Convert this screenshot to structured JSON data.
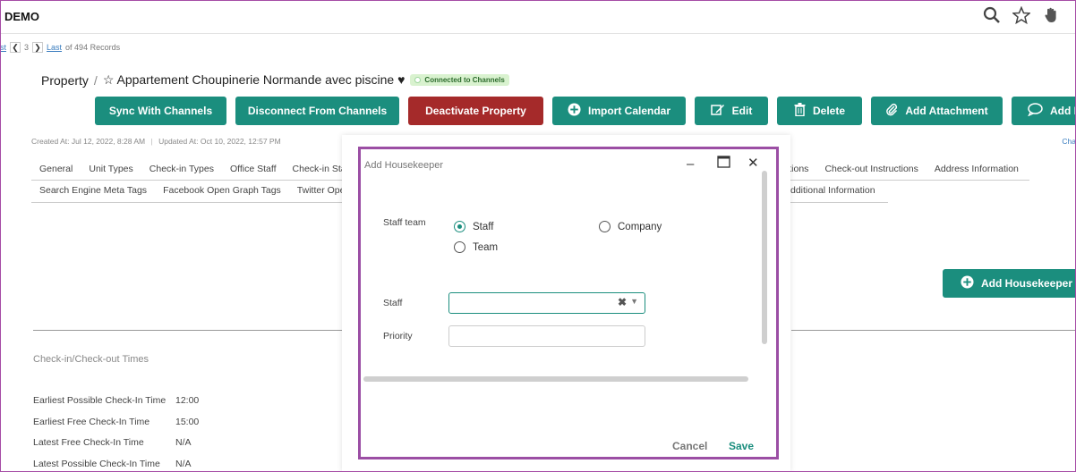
{
  "app": {
    "title": "DEMO"
  },
  "top_icons": [
    "search-icon",
    "star-icon",
    "hand-icon"
  ],
  "pager": {
    "first_fragment": "st",
    "page": "3",
    "last": "Last",
    "records": "of 494 Records"
  },
  "breadcrumb": {
    "root": "Property",
    "separator": "/",
    "title": "☆ Appartement Choupinerie Normande avec piscine ♥",
    "badge": "Connected to Channels"
  },
  "actions": [
    {
      "label": "Sync With Channels"
    },
    {
      "label": "Disconnect From Channels"
    },
    {
      "label": "Deactivate Property"
    },
    {
      "label": "Import Calendar",
      "icon": "plus-circle-icon"
    },
    {
      "label": "Edit",
      "icon": "edit-icon"
    },
    {
      "label": "Delete",
      "icon": "trash-icon"
    },
    {
      "label": "Add Attachment",
      "icon": "paperclip-icon"
    },
    {
      "label": "Add N",
      "icon": "comment-icon"
    }
  ],
  "meta": {
    "created": "Created At: Jul 12, 2022, 8:28 AM",
    "updated": "Updated At: Oct 10, 2022, 12:57 PM",
    "right_link": "Cha"
  },
  "tabs_row1": [
    "General",
    "Unit Types",
    "Check-in Types",
    "Office Staff",
    "Check-in Staf"
  ],
  "tabs_row1_right": [
    "ctions",
    "Check-out Instructions",
    "Address Information"
  ],
  "tabs_row2": [
    "Search Engine Meta Tags",
    "Facebook Open Graph Tags",
    "Twitter Open"
  ],
  "tabs_row2_right": "Additional Information",
  "add_housekeeper_button": "Add Housekeeper",
  "checkin_section": {
    "title": "Check-in/Check-out Times",
    "rows": [
      {
        "label": "Earliest Possible Check-In Time",
        "value": "12:00"
      },
      {
        "label": "Earliest Free Check-In Time",
        "value": "15:00"
      },
      {
        "label": "Latest Free Check-In Time",
        "value": "N/A"
      },
      {
        "label": "Latest Possible Check-In Time",
        "value": "N/A"
      }
    ]
  },
  "modal": {
    "title": "Add Housekeeper",
    "staff_team_label": "Staff team",
    "option_staff": "Staff",
    "option_team": "Team",
    "option_company": "Company",
    "selected_option": "Staff",
    "staff_label": "Staff",
    "staff_value": "",
    "priority_label": "Priority",
    "priority_value": "",
    "cancel": "Cancel",
    "save": "Save"
  },
  "colors": {
    "primary": "#1b8e7e",
    "danger": "#a52a2a",
    "accent_border": "#9b4ea4",
    "badge_bg": "#d9f2cf"
  }
}
